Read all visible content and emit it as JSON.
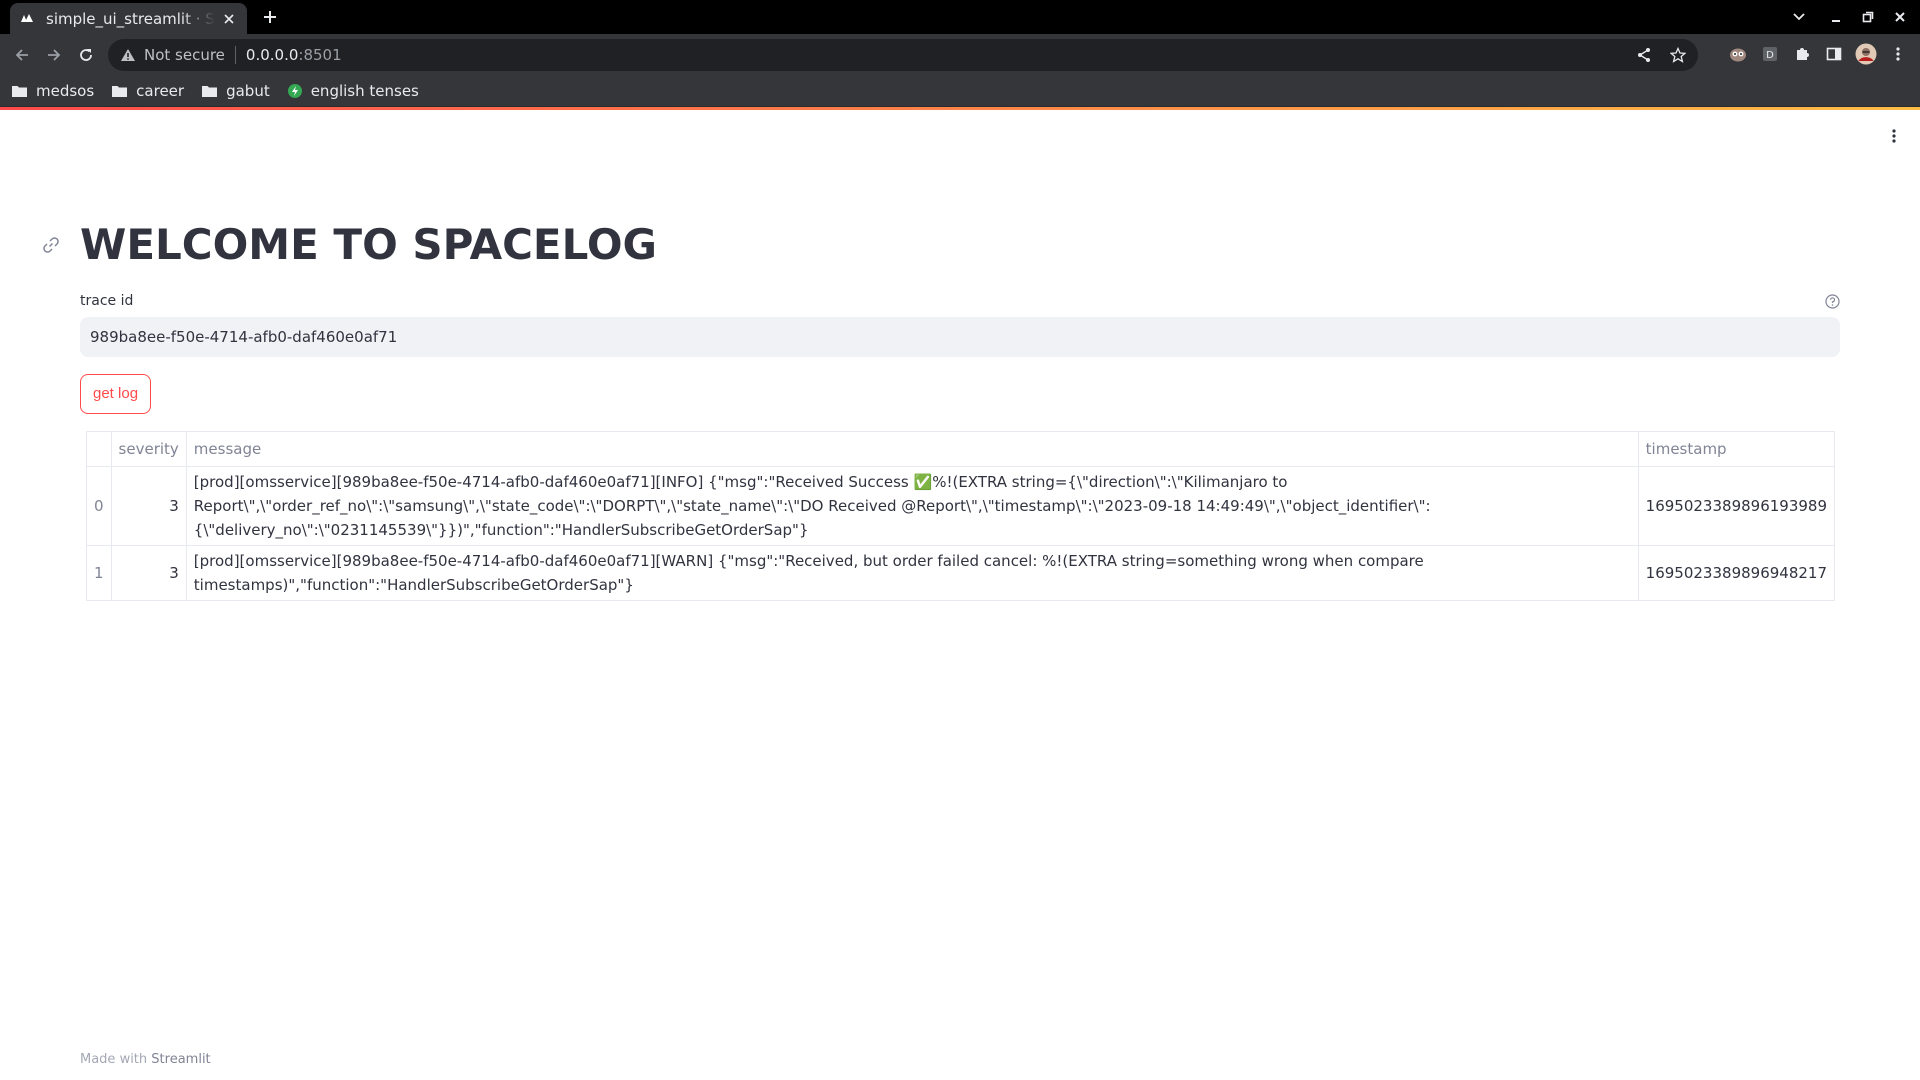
{
  "browser": {
    "tab_title": "simple_ui_streamlit · Streamlit",
    "security_label": "Not secure",
    "url_host": "0.0.0.0",
    "url_port": ":8501",
    "bookmarks": [
      {
        "label": "medsos",
        "icon": "folder-icon"
      },
      {
        "label": "career",
        "icon": "folder-icon"
      },
      {
        "label": "gabut",
        "icon": "folder-icon"
      },
      {
        "label": "english tenses",
        "icon": "site-favicon-icon"
      }
    ]
  },
  "app": {
    "title": "WELCOME TO SPACELOG",
    "trace_label": "trace id",
    "trace_value": "989ba8ee-f50e-4714-afb0-daf460e0af71",
    "button_label": "get log",
    "footer_prefix": "Made with",
    "footer_brand": "Streamlit",
    "accent_color": "#ff4b4b"
  },
  "table": {
    "columns": [
      "",
      "severity",
      "message",
      "timestamp"
    ],
    "rows": [
      {
        "index": "0",
        "severity": "3",
        "message": "[prod][omsservice][989ba8ee-f50e-4714-afb0-daf460e0af71][INFO] {\"msg\":\"Received Success ✅%!(EXTRA string={\\\"direction\\\":\\\"Kilimanjaro to Report\\\",\\\"order_ref_no\\\":\\\"samsung\\\",\\\"state_code\\\":\\\"DORPT\\\",\\\"state_name\\\":\\\"DO Received @Report\\\",\\\"timestamp\\\":\\\"2023-09-18 14:49:49\\\",\\\"object_identifier\\\":{\\\"delivery_no\\\":\\\"0231145539\\\"}})\",\"function\":\"HandlerSubscribeGetOrderSap\"}",
        "timestamp": "1695023389896193989"
      },
      {
        "index": "1",
        "severity": "3",
        "message": "[prod][omsservice][989ba8ee-f50e-4714-afb0-daf460e0af71][WARN] {\"msg\":\"Received, but order failed cancel: %!(EXTRA string=something wrong when compare timestamps)\",\"function\":\"HandlerSubscribeGetOrderSap\"}",
        "timestamp": "1695023389896948217"
      }
    ]
  }
}
